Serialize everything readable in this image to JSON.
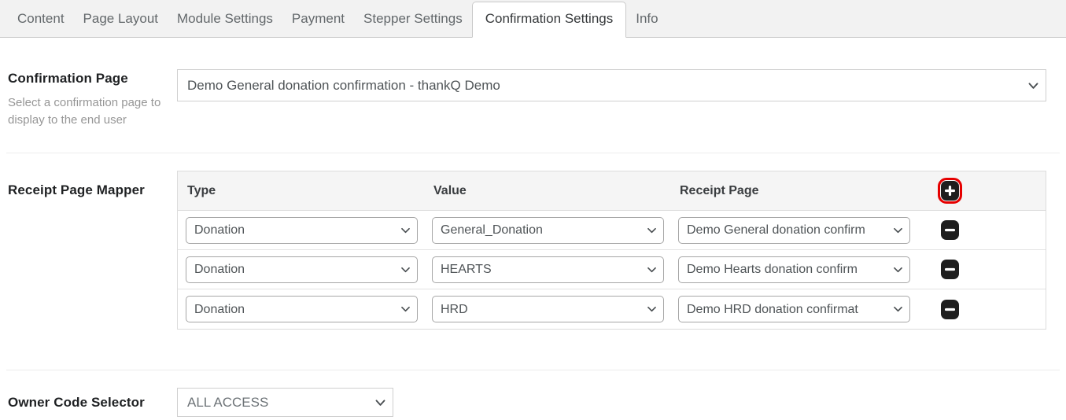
{
  "tabs": {
    "items": [
      {
        "label": "Content",
        "active": false
      },
      {
        "label": "Page Layout",
        "active": false
      },
      {
        "label": "Module Settings",
        "active": false
      },
      {
        "label": "Payment",
        "active": false
      },
      {
        "label": "Stepper Settings",
        "active": false
      },
      {
        "label": "Confirmation Settings",
        "active": true
      },
      {
        "label": "Info",
        "active": false
      }
    ]
  },
  "confirmation_page": {
    "label": "Confirmation Page",
    "help": "Select a confirmation page to display to the end user",
    "selected": "Demo General donation confirmation - thankQ Demo"
  },
  "receipt_mapper": {
    "label": "Receipt Page Mapper",
    "columns": {
      "type": "Type",
      "value": "Value",
      "receipt_page": "Receipt Page"
    },
    "rows": [
      {
        "type": "Donation",
        "value": "General_Donation",
        "receipt_page": "Demo General donation confirm"
      },
      {
        "type": "Donation",
        "value": "HEARTS",
        "receipt_page": "Demo Hearts donation confirm"
      },
      {
        "type": "Donation",
        "value": "HRD",
        "receipt_page": "Demo HRD donation confirmat"
      }
    ]
  },
  "owner_code": {
    "label": "Owner Code Selector",
    "selected": "ALL ACCESS"
  },
  "colors": {
    "accent_red": "#e60000",
    "button_dark": "#1e1e1e",
    "tabbar_bg": "#f2f2f2",
    "header_bg": "#f5f5f5"
  }
}
